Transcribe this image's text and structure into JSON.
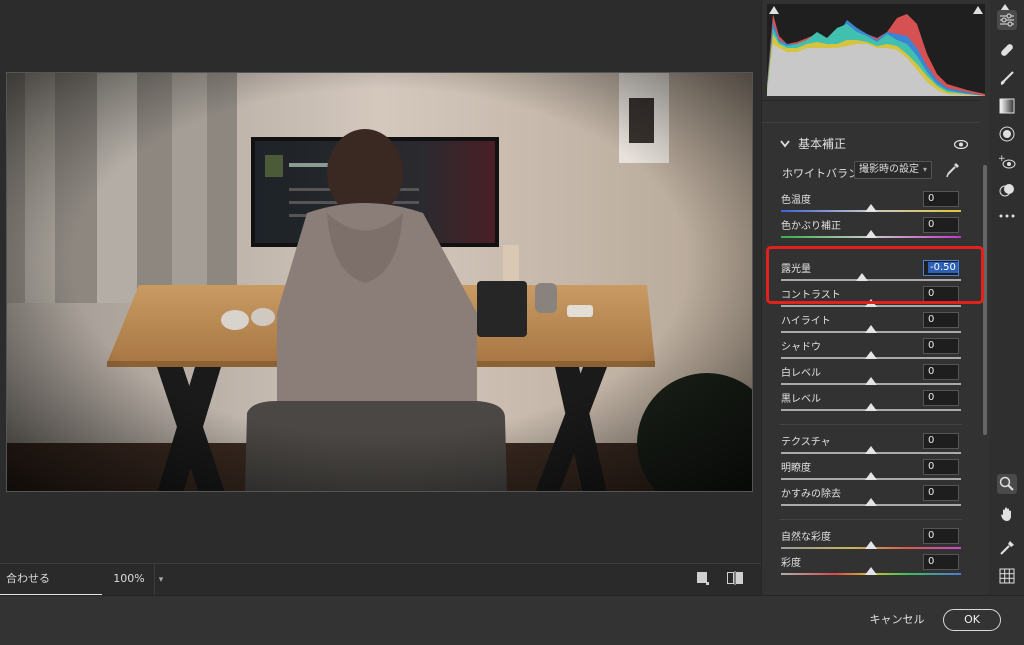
{
  "zoom_bar": {
    "fit_label": "合わせる (104.7%)",
    "percent_label": "100%",
    "dropdown_icon": "chevron-down-icon"
  },
  "panel": {
    "section_title": "基本補正",
    "white_balance": {
      "label": "ホワイトバランス",
      "value": "撮影時の設定"
    },
    "sliders": [
      {
        "key": "temperature",
        "label": "色温度",
        "value": "0",
        "pos": 0.5,
        "gradient": "linear-gradient(90deg,#3d63d6,#c9c9c9 50%,#e0c33a)"
      },
      {
        "key": "tint",
        "label": "色かぶり補正",
        "value": "0",
        "pos": 0.5,
        "gradient": "linear-gradient(90deg,#38b24a,#c9c9c9 50%,#c238c9)"
      },
      {
        "key": "exposure",
        "label": "露光量",
        "value": "-0.50",
        "pos": 0.45,
        "gradient": ""
      },
      {
        "key": "contrast",
        "label": "コントラスト",
        "value": "0",
        "pos": 0.5,
        "gradient": ""
      },
      {
        "key": "highlights",
        "label": "ハイライト",
        "value": "0",
        "pos": 0.5,
        "gradient": ""
      },
      {
        "key": "shadows",
        "label": "シャドウ",
        "value": "0",
        "pos": 0.5,
        "gradient": ""
      },
      {
        "key": "whites",
        "label": "白レベル",
        "value": "0",
        "pos": 0.5,
        "gradient": ""
      },
      {
        "key": "blacks",
        "label": "黒レベル",
        "value": "0",
        "pos": 0.5,
        "gradient": ""
      },
      {
        "key": "texture",
        "label": "テクスチャ",
        "value": "0",
        "pos": 0.5,
        "gradient": ""
      },
      {
        "key": "clarity",
        "label": "明瞭度",
        "value": "0",
        "pos": 0.5,
        "gradient": ""
      },
      {
        "key": "dehaze",
        "label": "かすみの除去",
        "value": "0",
        "pos": 0.5,
        "gradient": ""
      },
      {
        "key": "vibrance",
        "label": "自然な彩度",
        "value": "0",
        "pos": 0.5,
        "gradient": "linear-gradient(90deg,#9a9a9a,#c7b55a 40%,#d95d4a 70%,#c44bd0)"
      },
      {
        "key": "saturation",
        "label": "彩度",
        "value": "0",
        "pos": 0.5,
        "gradient": "linear-gradient(90deg,#b0b0b0,#d84a4a 30%,#d2c23a 50%,#3fbf5a 70%,#4c7ad9)"
      }
    ]
  },
  "footer": {
    "cancel_label": "キャンセル",
    "ok_label": "OK"
  },
  "colors": {
    "highlight": "#e3211c",
    "accent": "#2d5fb4"
  }
}
